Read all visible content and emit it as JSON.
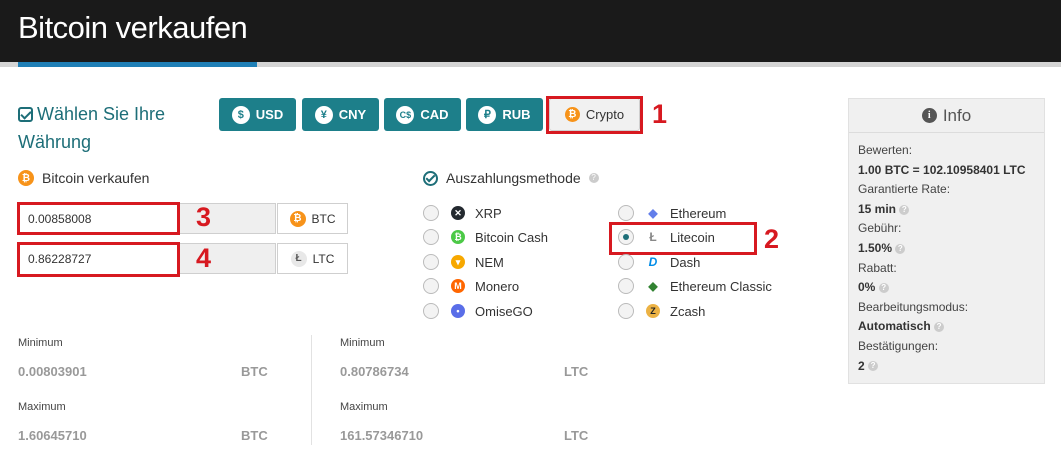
{
  "header": {
    "title": "Bitcoin verkaufen"
  },
  "currency": {
    "heading": "Wählen Sie Ihre Währung",
    "buttons": [
      {
        "label": "USD",
        "icon": "dollar-icon",
        "glyph": "$"
      },
      {
        "label": "CNY",
        "icon": "yuan-icon",
        "glyph": "¥"
      },
      {
        "label": "CAD",
        "icon": "cad-dollar-icon",
        "glyph": "C$"
      },
      {
        "label": "RUB",
        "icon": "ruble-icon",
        "glyph": "₽"
      },
      {
        "label": "Crypto",
        "icon": "bitcoin-icon",
        "glyph": "₿",
        "selected": true
      }
    ]
  },
  "markers": {
    "m1": "1",
    "m2": "2",
    "m3": "3",
    "m4": "4"
  },
  "sell": {
    "label": "Bitcoin verkaufen",
    "from_value": "0.00858008",
    "from_unit": "BTC",
    "to_value": "0.86228727",
    "to_unit": "LTC"
  },
  "payout": {
    "label": "Auszahlungsmethode",
    "options_left": [
      {
        "label": "XRP",
        "icon": "xrp-icon",
        "color": "#23292f"
      },
      {
        "label": "Bitcoin Cash",
        "icon": "bitcoin-cash-icon",
        "color": "#4cc947"
      },
      {
        "label": "NEM",
        "icon": "nem-icon",
        "color": "#f7a800"
      },
      {
        "label": "Monero",
        "icon": "monero-icon",
        "color": "#ff6600"
      },
      {
        "label": "OmiseGO",
        "icon": "omisego-icon",
        "color": "#5a6ee8"
      }
    ],
    "options_right": [
      {
        "label": "Ethereum",
        "icon": "ethereum-icon",
        "color": "#627eea"
      },
      {
        "label": "Litecoin",
        "icon": "litecoin-icon",
        "color": "#bfbbbb",
        "selected": true
      },
      {
        "label": "Dash",
        "icon": "dash-icon",
        "color": "#008ce7"
      },
      {
        "label": "Ethereum Classic",
        "icon": "ethereum-classic-icon",
        "color": "#328332"
      },
      {
        "label": "Zcash",
        "icon": "zcash-icon",
        "color": "#ecb244"
      }
    ]
  },
  "limits": {
    "min_label": "Minimum",
    "max_label": "Maximum",
    "btc_min": "0.00803901",
    "btc_max": "1.60645710",
    "btc_unit": "BTC",
    "ltc_min": "0.80786734",
    "ltc_max": "161.57346710",
    "ltc_unit": "LTC"
  },
  "info": {
    "title": "Info",
    "rows": [
      {
        "label": "Bewerten:",
        "value": "1.00 BTC = 102.10958401 LTC"
      },
      {
        "label": "Garantierte Rate:",
        "value": "15 min"
      },
      {
        "label": "Gebühr:",
        "value": "1.50%"
      },
      {
        "label": "Rabatt:",
        "value": "0%"
      },
      {
        "label": "Bearbeitungsmodus:",
        "value": "Automatisch"
      },
      {
        "label": "Bestätigungen:",
        "value": "2"
      }
    ]
  },
  "colors": {
    "accent": "#1d7f8a",
    "heading": "#1d6e78",
    "marker": "#d71920",
    "bitcoin": "#f7931a"
  }
}
